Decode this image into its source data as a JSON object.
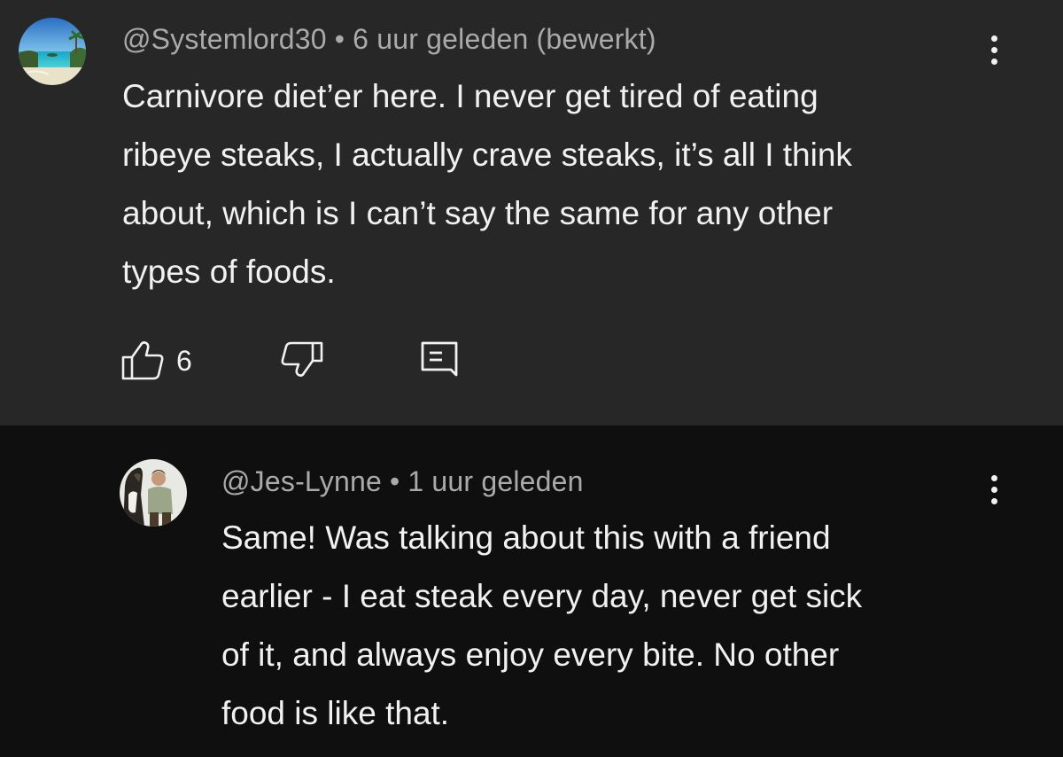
{
  "comments": [
    {
      "author": "@Systemlord30",
      "separator": "•",
      "time": "6 uur geleden (bewerkt)",
      "lines": [
        "Carnivore diet’er here. I never get tired of eating",
        "ribeye steaks, I actually crave steaks, it’s all I think",
        "about, which is I can’t say the same for any other",
        "types of foods."
      ],
      "like_count": "6",
      "avatar": "beach-avatar"
    },
    {
      "author": "@Jes-Lynne",
      "separator": "•",
      "time": "1 uur geleden",
      "lines": [
        "Same! Was talking about this with a friend",
        "earlier - I eat steak every day, never get sick",
        "of it, and always enjoy every bite. No other",
        "food is like that."
      ],
      "avatar": "person-with-horse-avatar"
    }
  ],
  "icons": {
    "like": "thumbs-up-icon",
    "dislike": "thumbs-down-icon",
    "reply": "comment-icon",
    "menu": "more-vertical-icon"
  },
  "colors": {
    "main_bg": "#272727",
    "reply_bg": "#0f0f0f",
    "text": "#f1f1f1",
    "meta": "#aaaaaa"
  }
}
